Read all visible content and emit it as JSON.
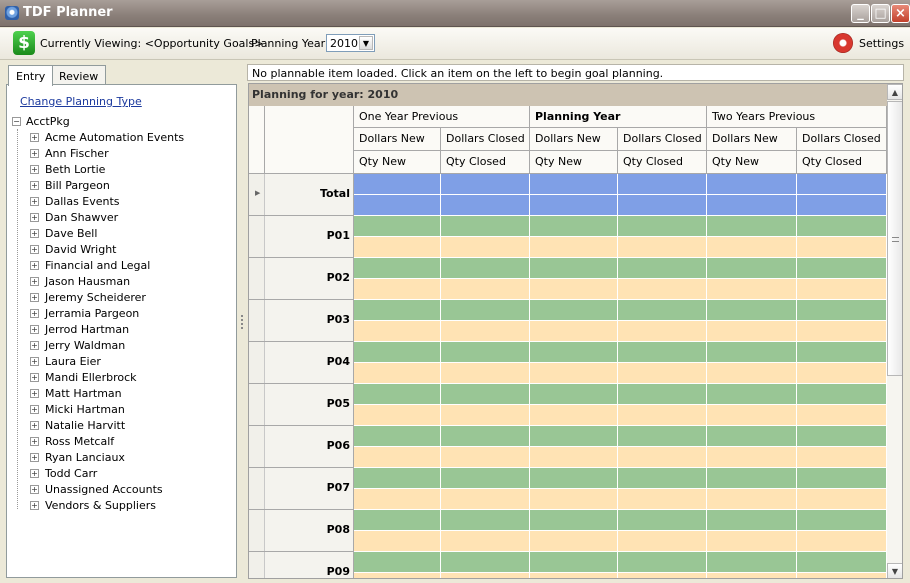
{
  "window": {
    "title": "TDF Planner"
  },
  "toolbar": {
    "viewing_label": "Currently Viewing: <Opportunity Goals>",
    "planning_year_label": "Planning Year:",
    "planning_year_value": "2010",
    "settings_label": "Settings"
  },
  "tabs": [
    {
      "label": "Entry"
    },
    {
      "label": "Review"
    }
  ],
  "left": {
    "change_link": "Change Planning Type",
    "root": "AcctPkg",
    "items": [
      "Acme Automation Events",
      "Ann Fischer",
      "Beth Lortie",
      "Bill Pargeon",
      "Dallas Events",
      "Dan Shawver",
      "Dave Bell",
      "David Wright",
      "Financial and Legal",
      "Jason Hausman",
      "Jeremy Scheiderer",
      "Jerramia Pargeon",
      "Jerrod Hartman",
      "Jerry Waldman",
      "Laura Eier",
      "Mandi Ellerbrock",
      "Matt Hartman",
      "Micki Hartman",
      "Natalie Harvitt",
      "Ross Metcalf",
      "Ryan Lanciaux",
      "Todd Carr",
      "Unassigned Accounts",
      "Vendors & Suppliers"
    ]
  },
  "message": "No plannable item loaded. Click an item on the left to begin goal planning.",
  "grid": {
    "header": "Planning for year: 2010",
    "groups": [
      "One Year Previous",
      "Planning Year",
      "Two Years Previous"
    ],
    "sub1": [
      "Dollars New",
      "Dollars Closed"
    ],
    "sub2": [
      "Qty New",
      "Qty Closed"
    ],
    "rows": [
      "Total",
      "P01",
      "P02",
      "P03",
      "P04",
      "P05",
      "P06",
      "P07",
      "P08",
      "P09"
    ],
    "colors": {
      "total": "#7f9fe6",
      "top": "#99c695",
      "bottom": "#ffe3b4"
    }
  }
}
